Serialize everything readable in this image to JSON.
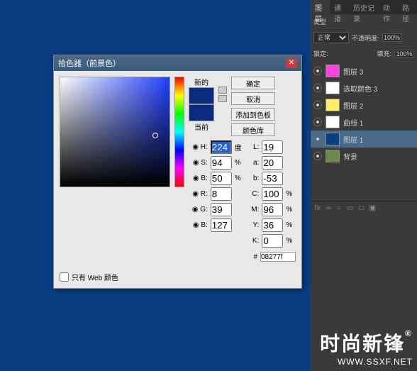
{
  "panels": {
    "tabs": [
      "图层",
      "通道",
      "历史记录",
      "动作",
      "路径"
    ],
    "blendRow": {
      "kind": "类型",
      "mode": "正常",
      "opacityLabel": "不透明度:",
      "opacity": "100%",
      "lockLabel": "锁定:",
      "fillLabel": "填充:",
      "fill": "100%"
    },
    "layers": [
      {
        "name": "图层 3",
        "color": "#ff44dd"
      },
      {
        "name": "选取颜色 3",
        "color": "#ffffff"
      },
      {
        "name": "图层 2",
        "color": "#ffee66"
      },
      {
        "name": "曲线 1",
        "color": "#ffffff"
      },
      {
        "name": "图层 1",
        "color": "#0a3d82",
        "sel": true
      },
      {
        "name": "背景",
        "color": "#6a8a4a"
      }
    ],
    "footerIcons": [
      "fx",
      "∞",
      "○",
      "▭",
      "□",
      "▣"
    ]
  },
  "dialog": {
    "title": "拾色器（前景色）",
    "newLabel": "新的",
    "currentLabel": "当前",
    "newColor": "#0a2a7f",
    "currentColor": "#0a2a7f",
    "buttons": {
      "ok": "确定",
      "cancel": "取消",
      "addSwatch": "添加到色板",
      "colorLib": "颜色库"
    },
    "fields": {
      "H": {
        "label": "H:",
        "val": "224",
        "unit": "度"
      },
      "S": {
        "label": "S:",
        "val": "94",
        "unit": "%"
      },
      "Bv": {
        "label": "B:",
        "val": "50",
        "unit": "%"
      },
      "R": {
        "label": "R:",
        "val": "8",
        "unit": ""
      },
      "G": {
        "label": "G:",
        "val": "39",
        "unit": ""
      },
      "B": {
        "label": "B:",
        "val": "127",
        "unit": ""
      },
      "L": {
        "label": "L:",
        "val": "19",
        "unit": ""
      },
      "a": {
        "label": "a:",
        "val": "20",
        "unit": ""
      },
      "b": {
        "label": "b:",
        "val": "-53",
        "unit": ""
      },
      "C": {
        "label": "C:",
        "val": "100",
        "unit": "%"
      },
      "M": {
        "label": "M:",
        "val": "96",
        "unit": "%"
      },
      "Y": {
        "label": "Y:",
        "val": "36",
        "unit": "%"
      },
      "K": {
        "label": "K:",
        "val": "0",
        "unit": "%"
      }
    },
    "hex": "08277f",
    "webOnly": "只有 Web 颜色"
  },
  "watermark": {
    "big": "时尚新锋",
    "small": "WWW.SSXF.NET"
  }
}
